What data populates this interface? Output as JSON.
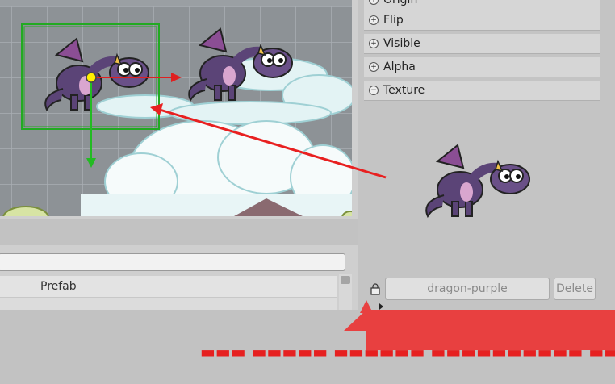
{
  "inspector": {
    "properties": [
      {
        "label": "Origin",
        "sign": "+"
      },
      {
        "label": "Flip",
        "sign": "+"
      },
      {
        "label": "Visible",
        "sign": "+"
      },
      {
        "label": "Alpha",
        "sign": "+"
      },
      {
        "label": "Texture",
        "sign": "−"
      }
    ],
    "texture": {
      "name": "dragon-purple",
      "delete_label": "Delete"
    }
  },
  "assets": {
    "items": [
      {
        "label": "Prefab"
      }
    ]
  },
  "colors": {
    "selection": "#22aa22",
    "x_axis": "#e02020",
    "y_axis": "#22bb22",
    "pivot": "#ffee00",
    "annotation": "#e84040"
  },
  "annotation": {
    "caption": "▬▬▬ ▬▬▬▬▬ ▬▬▬▬▬▬ ▬▬▬▬▬▬▬▬▬▬ ▬▬▬▬ ▬▬▬▬▬▬▬▬ ▬▬▬▬▬"
  }
}
